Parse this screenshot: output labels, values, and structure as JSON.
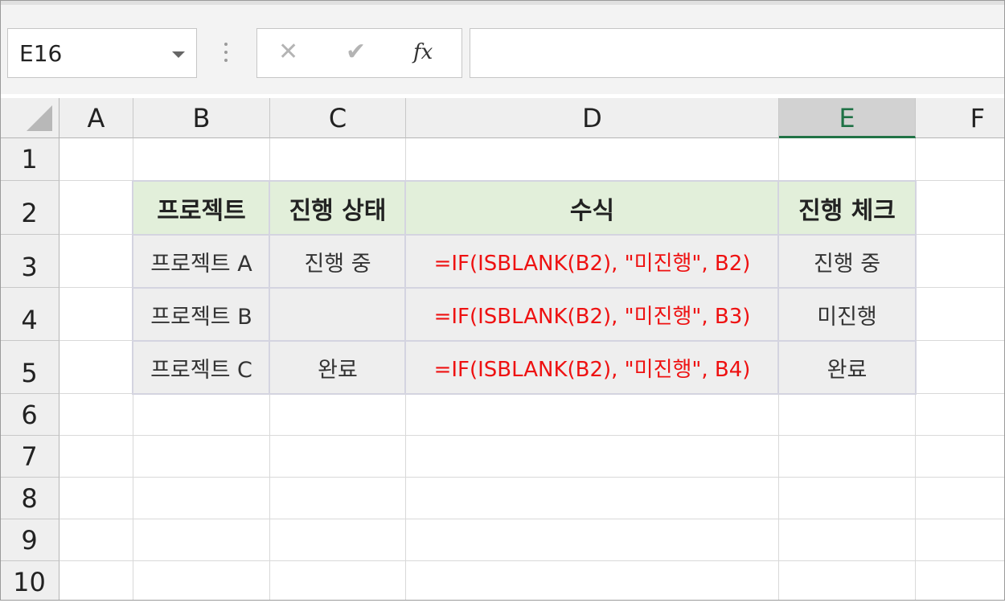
{
  "formula_bar": {
    "name_box": "E16",
    "cancel_icon": "✕",
    "enter_icon": "✔",
    "fx_label": "fx",
    "formula_value": ""
  },
  "sheet": {
    "selected_column": "E",
    "columns": [
      "A",
      "B",
      "C",
      "D",
      "E",
      "F"
    ],
    "rows": [
      "1",
      "2",
      "3",
      "4",
      "5",
      "6",
      "7",
      "8",
      "9",
      "10"
    ],
    "table": {
      "headers": [
        "프로젝트",
        "진행 상태",
        "수식",
        "진행 체크"
      ],
      "rows": [
        [
          "프로젝트 A",
          "진행 중",
          "=IF(ISBLANK(B2), \"미진행\", B2)",
          "진행 중"
        ],
        [
          "프로젝트 B",
          "",
          "=IF(ISBLANK(B2), \"미진행\", B3)",
          "미진행"
        ],
        [
          "프로젝트 C",
          "완료",
          "=IF(ISBLANK(B2), \"미진행\", B4)",
          "완료"
        ]
      ]
    }
  },
  "colors": {
    "header_fill": "#e2efda",
    "cell_fill": "#eeeeee",
    "formula_text": "#ee1111",
    "selection_accent": "#217346"
  }
}
